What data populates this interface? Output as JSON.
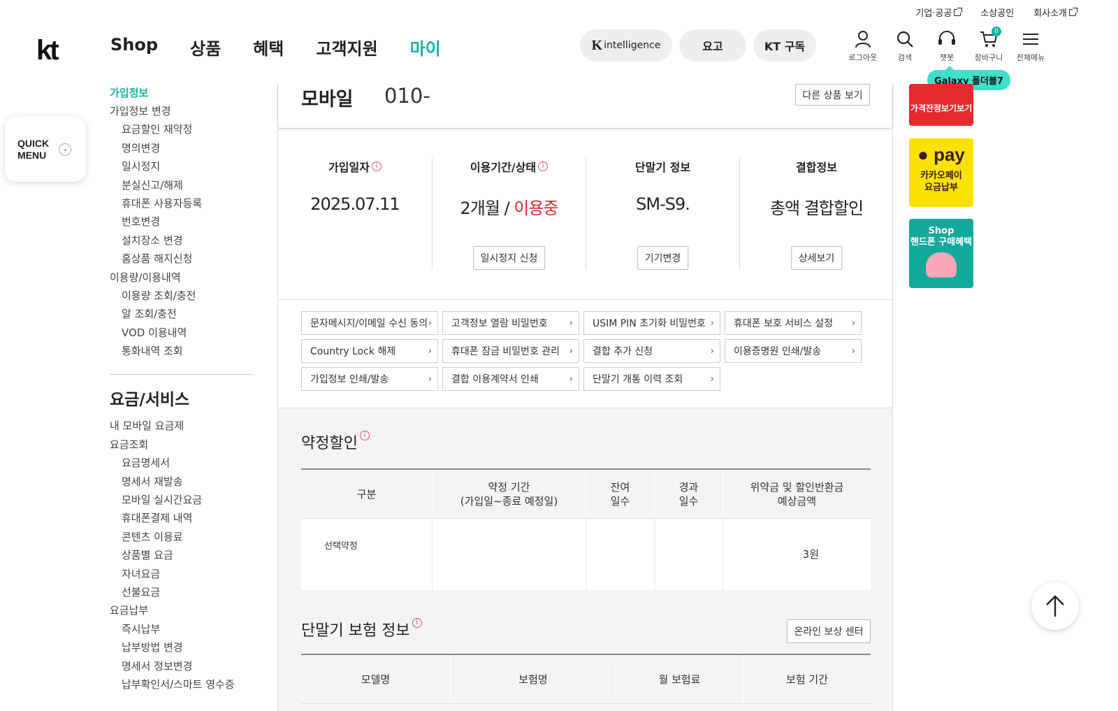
{
  "util_links": {
    "corporate": "기업·공공",
    "small_business": "소상공인",
    "company": "회사소개"
  },
  "header": {
    "logo": "kt",
    "nav": [
      "Shop",
      "상품",
      "혜택",
      "고객지원",
      "마이"
    ],
    "active_nav": "마이",
    "pills": {
      "intelligence": "intelligence",
      "yogo": "요고",
      "kt_subscribe": "KT 구독"
    },
    "icons": {
      "logout": "로그아웃",
      "search": "검색",
      "chatbot": "챗봇",
      "cart": "장바구니",
      "cart_count": "0",
      "all_menu": "전체메뉴"
    },
    "promo_badge": "Galaxy 폴더블7"
  },
  "quick_menu": {
    "line1": "QUICK",
    "line2": "MENU"
  },
  "sidebar": {
    "section1_title": "가입정보",
    "section1": [
      {
        "label": "가입정보 변경",
        "level": 1
      },
      {
        "label": "요금할인 재약정",
        "level": 2
      },
      {
        "label": "명의변경",
        "level": 2
      },
      {
        "label": "일시정지",
        "level": 2
      },
      {
        "label": "분실신고/해제",
        "level": 2
      },
      {
        "label": "휴대폰 사용자등록",
        "level": 2
      },
      {
        "label": "번호변경",
        "level": 2
      },
      {
        "label": "설치장소 변경",
        "level": 2
      },
      {
        "label": "홈상품 해지신청",
        "level": 2
      },
      {
        "label": "이용량/이용내역",
        "level": 1
      },
      {
        "label": "이용량 조회/충전",
        "level": 2
      },
      {
        "label": "알 조회/충전",
        "level": 2
      },
      {
        "label": "VOD 이용내역",
        "level": 2
      },
      {
        "label": "통화내역 조회",
        "level": 2
      }
    ],
    "section2_title": "요금/서비스",
    "section2": [
      {
        "label": "내 모바일 요금제",
        "level": 1
      },
      {
        "label": "요금조회",
        "level": 1
      },
      {
        "label": "요금명세서",
        "level": 2
      },
      {
        "label": "명세서 재발송",
        "level": 2
      },
      {
        "label": "모바일 실시간요금",
        "level": 2
      },
      {
        "label": "휴대폰결제 내역",
        "level": 2
      },
      {
        "label": "콘텐츠 이용료",
        "level": 2
      },
      {
        "label": "상품별 요금",
        "level": 2
      },
      {
        "label": "자녀요금",
        "level": 2
      },
      {
        "label": "선불요금",
        "level": 2
      },
      {
        "label": "요금납부",
        "level": 1
      },
      {
        "label": "즉시납부",
        "level": 2
      },
      {
        "label": "납부방법 변경",
        "level": 2
      },
      {
        "label": "명세서 정보변경",
        "level": 2
      },
      {
        "label": "납부확인서/스마트 영수증",
        "level": 2
      }
    ]
  },
  "product_card": {
    "type": "모바일",
    "number": "010-",
    "other_button": "다른 상품 보기"
  },
  "info_columns": [
    {
      "header": "가입일자",
      "has_info": true,
      "value": "2025.07.11",
      "button": ""
    },
    {
      "header": "이용기간/상태",
      "has_info": true,
      "value": "2개월 / ",
      "value_red": "이용중",
      "button": "일시정지 신청"
    },
    {
      "header": "단말기 정보",
      "has_info": false,
      "value": "SM-S9.",
      "button": "기기변경"
    },
    {
      "header": "결합정보",
      "has_info": false,
      "value": "총액 결합할인",
      "button": "상세보기"
    }
  ],
  "quick_links": [
    "문자메시지/이메일 수신 동의",
    "고객정보 열람 비밀번호",
    "USIM PIN 초기화 비밀번호",
    "휴대폰 보호 서비스 설정",
    "Country Lock 해제",
    "휴대폰 잠금 비밀번호 관리",
    "결합 추가 신청",
    "이용증명원 인쇄/발송",
    "가입정보 인쇄/발송",
    "결합 이용계약서 인쇄",
    "단말기 개통 이력 조회"
  ],
  "contract": {
    "title": "약정할인",
    "headers": [
      "구분",
      "약정 기간\n(가입일~종료 예정일)",
      "잔여\n일수",
      "경과\n일수",
      "위약금 및 할인반환금\n예상금액"
    ],
    "row": [
      "선택약정",
      "",
      "",
      "",
      "3원"
    ]
  },
  "insurance": {
    "title": "단말기 보험 정보",
    "reward_button": "온라인 보상 센터",
    "headers": [
      "모델명",
      "보험명",
      "월 보험료",
      "보험 기간"
    ]
  },
  "banners": {
    "b1": "가격잔정보기보기",
    "b2_logo": "pay",
    "b2_line1": "카카오페이",
    "b2_line2": "요금납부",
    "b3_line1": "Shop",
    "b3_line2": "핸드폰 구매혜택"
  },
  "colors": {
    "accent": "#13b3a3",
    "status_red": "#e0252f",
    "kakao_yellow": "#fae100"
  }
}
